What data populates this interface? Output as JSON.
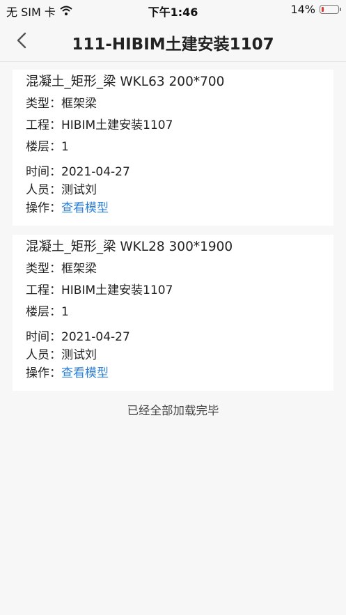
{
  "status_bar": {
    "carrier": "无 SIM 卡",
    "time": "下午1:46",
    "battery_text": "14%",
    "battery_level": 0.14,
    "battery_color": "#e53935"
  },
  "nav": {
    "title": "111-HIBIM土建安装1107",
    "back_icon": "chevron-left-icon"
  },
  "labels": {
    "type": "类型：",
    "project": "工程：",
    "floor": "楼层：",
    "time": "时间：",
    "person": "人员：",
    "action": "操作："
  },
  "items": [
    {
      "title": "混凝土_矩形_梁 WKL63 200*700",
      "type": "框架梁",
      "project": "HIBIM土建安装1107",
      "floor": "1",
      "time": "2021-04-27",
      "person": "测试刘",
      "action_link": "查看模型"
    },
    {
      "title": "混凝土_矩形_梁 WKL28 300*1900",
      "type": "框架梁",
      "project": "HIBIM土建安装1107",
      "floor": "1",
      "time": "2021-04-27",
      "person": "测试刘",
      "action_link": "查看模型"
    }
  ],
  "footer_text": "已经全部加载完毕",
  "colors": {
    "link": "#2f80d8",
    "background": "#f7f7f7"
  }
}
